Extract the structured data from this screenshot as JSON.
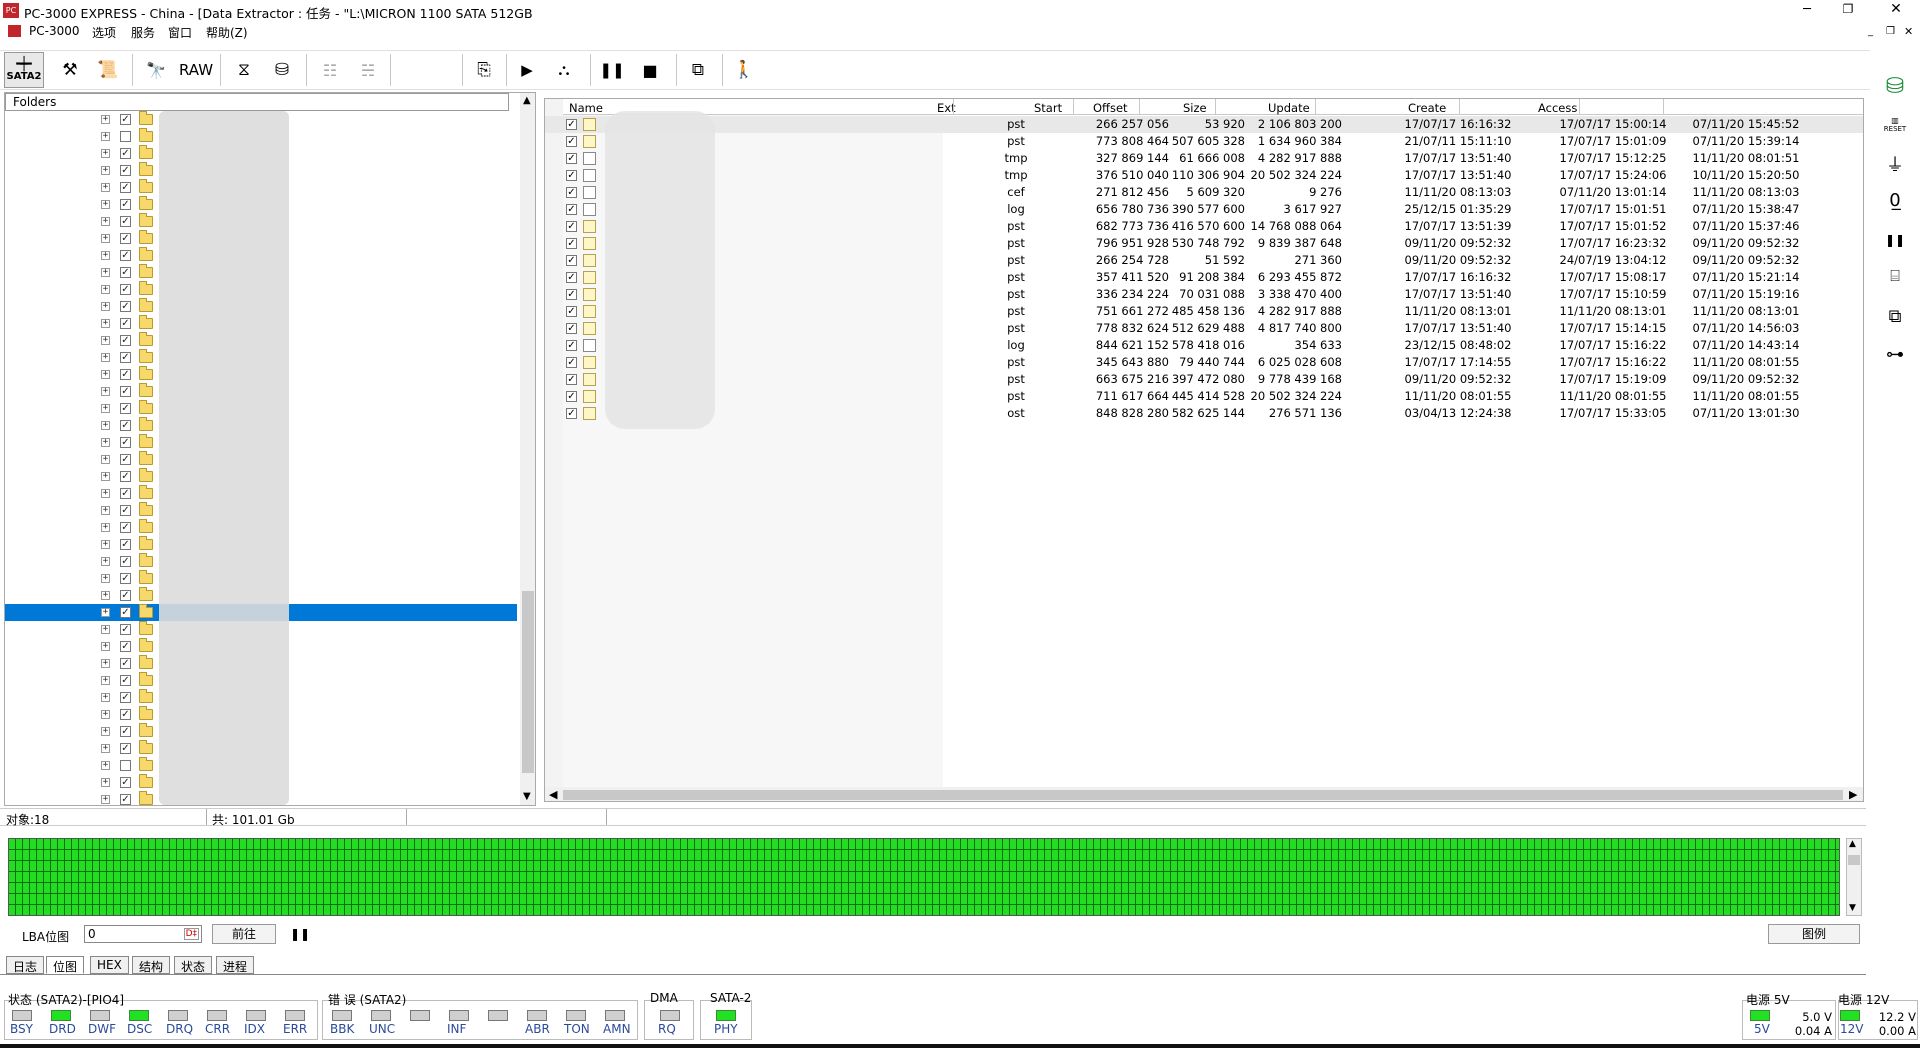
{
  "window": {
    "title": "PC-3000 EXPRESS - China - [Data Extractor : 任务 - \"L:\\MICRON 1100 SATA 512GB"
  },
  "menu": [
    "PC-3000",
    "选项",
    "服务",
    "窗口",
    "帮助(Z)"
  ],
  "toolbar": {
    "sata_label": "SATA2",
    "raw_label": "RAW"
  },
  "folders": {
    "header": "Folders",
    "row_count": 42,
    "selected_index": 29
  },
  "table": {
    "columns": [
      "Name",
      "Ext",
      "Start",
      "Offset",
      "Size",
      "Update",
      "Create",
      "Access"
    ],
    "rows": [
      [
        "pst",
        "266 257 056",
        "53 920",
        "2 106 803 200",
        "17/07/17 16:16:32",
        "17/07/17 15:00:14",
        "07/11/20 15:45:52"
      ],
      [
        "pst",
        "773 808 464",
        "507 605 328",
        "1 634 960 384",
        "21/07/11 15:11:10",
        "17/07/17 15:01:09",
        "07/11/20 15:39:14"
      ],
      [
        "tmp",
        "327 869 144",
        "61 666 008",
        "4 282 917 888",
        "17/07/17 13:51:40",
        "17/07/17 15:12:25",
        "11/11/20 08:01:51"
      ],
      [
        "tmp",
        "376 510 040",
        "110 306 904",
        "20 502 324 224",
        "17/07/17 13:51:40",
        "17/07/17 15:24:06",
        "10/11/20 15:20:50"
      ],
      [
        "cef",
        "271 812 456",
        "5 609 320",
        "9 276",
        "11/11/20 08:13:03",
        "07/11/20 13:01:14",
        "11/11/20 08:13:03"
      ],
      [
        "log",
        "656 780 736",
        "390 577 600",
        "3 617 927",
        "25/12/15 01:35:29",
        "17/07/17 15:01:51",
        "07/11/20 15:38:47"
      ],
      [
        "pst",
        "682 773 736",
        "416 570 600",
        "14 768 088 064",
        "17/07/17 13:51:39",
        "17/07/17 15:01:52",
        "07/11/20 15:37:46"
      ],
      [
        "pst",
        "796 951 928",
        "530 748 792",
        "9 839 387 648",
        "09/11/20 09:52:32",
        "17/07/17 16:23:32",
        "09/11/20 09:52:32"
      ],
      [
        "pst",
        "266 254 728",
        "51 592",
        "271 360",
        "09/11/20 09:52:32",
        "24/07/19 13:04:12",
        "09/11/20 09:52:32"
      ],
      [
        "pst",
        "357 411 520",
        "91 208 384",
        "6 293 455 872",
        "17/07/17 16:16:32",
        "17/07/17 15:08:17",
        "07/11/20 15:21:14"
      ],
      [
        "pst",
        "336 234 224",
        "70 031 088",
        "3 338 470 400",
        "17/07/17 13:51:40",
        "17/07/17 15:10:59",
        "07/11/20 15:19:16"
      ],
      [
        "pst",
        "751 661 272",
        "485 458 136",
        "4 282 917 888",
        "11/11/20 08:13:01",
        "11/11/20 08:13:01",
        "11/11/20 08:13:01"
      ],
      [
        "pst",
        "778 832 624",
        "512 629 488",
        "4 817 740 800",
        "17/07/17 13:51:40",
        "17/07/17 15:14:15",
        "07/11/20 14:56:03"
      ],
      [
        "log",
        "844 621 152",
        "578 418 016",
        "354 633",
        "23/12/15 08:48:02",
        "17/07/17 15:16:22",
        "07/11/20 14:43:14"
      ],
      [
        "pst",
        "345 643 880",
        "79 440 744",
        "6 025 028 608",
        "17/07/17 17:14:55",
        "17/07/17 15:16:22",
        "11/11/20 08:01:55"
      ],
      [
        "pst",
        "663 675 216",
        "397 472 080",
        "9 778 439 168",
        "09/11/20 09:52:32",
        "17/07/17 15:19:09",
        "09/11/20 09:52:32"
      ],
      [
        "pst",
        "711 617 664",
        "445 414 528",
        "20 502 324 224",
        "11/11/20 08:01:55",
        "11/11/20 08:01:55",
        "11/11/20 08:01:55"
      ],
      [
        "ost",
        "848 828 280",
        "582 625 144",
        "276 571 136",
        "03/04/13 12:24:38",
        "17/07/17 15:33:05",
        "07/11/20 13:01:30"
      ]
    ]
  },
  "statusbar": {
    "objects": "对象:18",
    "total": "共: 101.01 Gb"
  },
  "lba": {
    "label": "LBA位图",
    "value": "0",
    "go_label": "前往",
    "legend_label": "图例"
  },
  "tabs": [
    "日志",
    "位图",
    "HEX",
    "结构",
    "状态",
    "进程"
  ],
  "status_groups": {
    "state_title": "状态 (SATA2)-[PIO4]",
    "error_title": "错 误 (SATA2)",
    "dma_title": "DMA",
    "sata_title": "SATA-2",
    "power5_title": "电源 5V",
    "power12_title": "电源 12V",
    "state_leds": [
      "BSY",
      "DRD",
      "DWF",
      "DSC",
      "DRQ",
      "CRR",
      "IDX",
      "ERR"
    ],
    "state_on": [
      false,
      true,
      false,
      true,
      false,
      false,
      false,
      false
    ],
    "error_leds": [
      "BBK",
      "UNC",
      "",
      "INF",
      "",
      "ABR",
      "TON",
      "AMN"
    ],
    "dma_leds": [
      "RQ"
    ],
    "sata_leds": [
      "PHY"
    ],
    "p5": {
      "label": "5V",
      "volt": "5.0 V",
      "amp": "0.04 A"
    },
    "p12": {
      "label": "12V",
      "volt": "12.2 V",
      "amp": "0.00 A"
    }
  },
  "colors": {
    "accent": "#0078d7",
    "led_on": "#22e022",
    "led_off": "#cfcfcf",
    "bitmap": "#22dd22"
  }
}
